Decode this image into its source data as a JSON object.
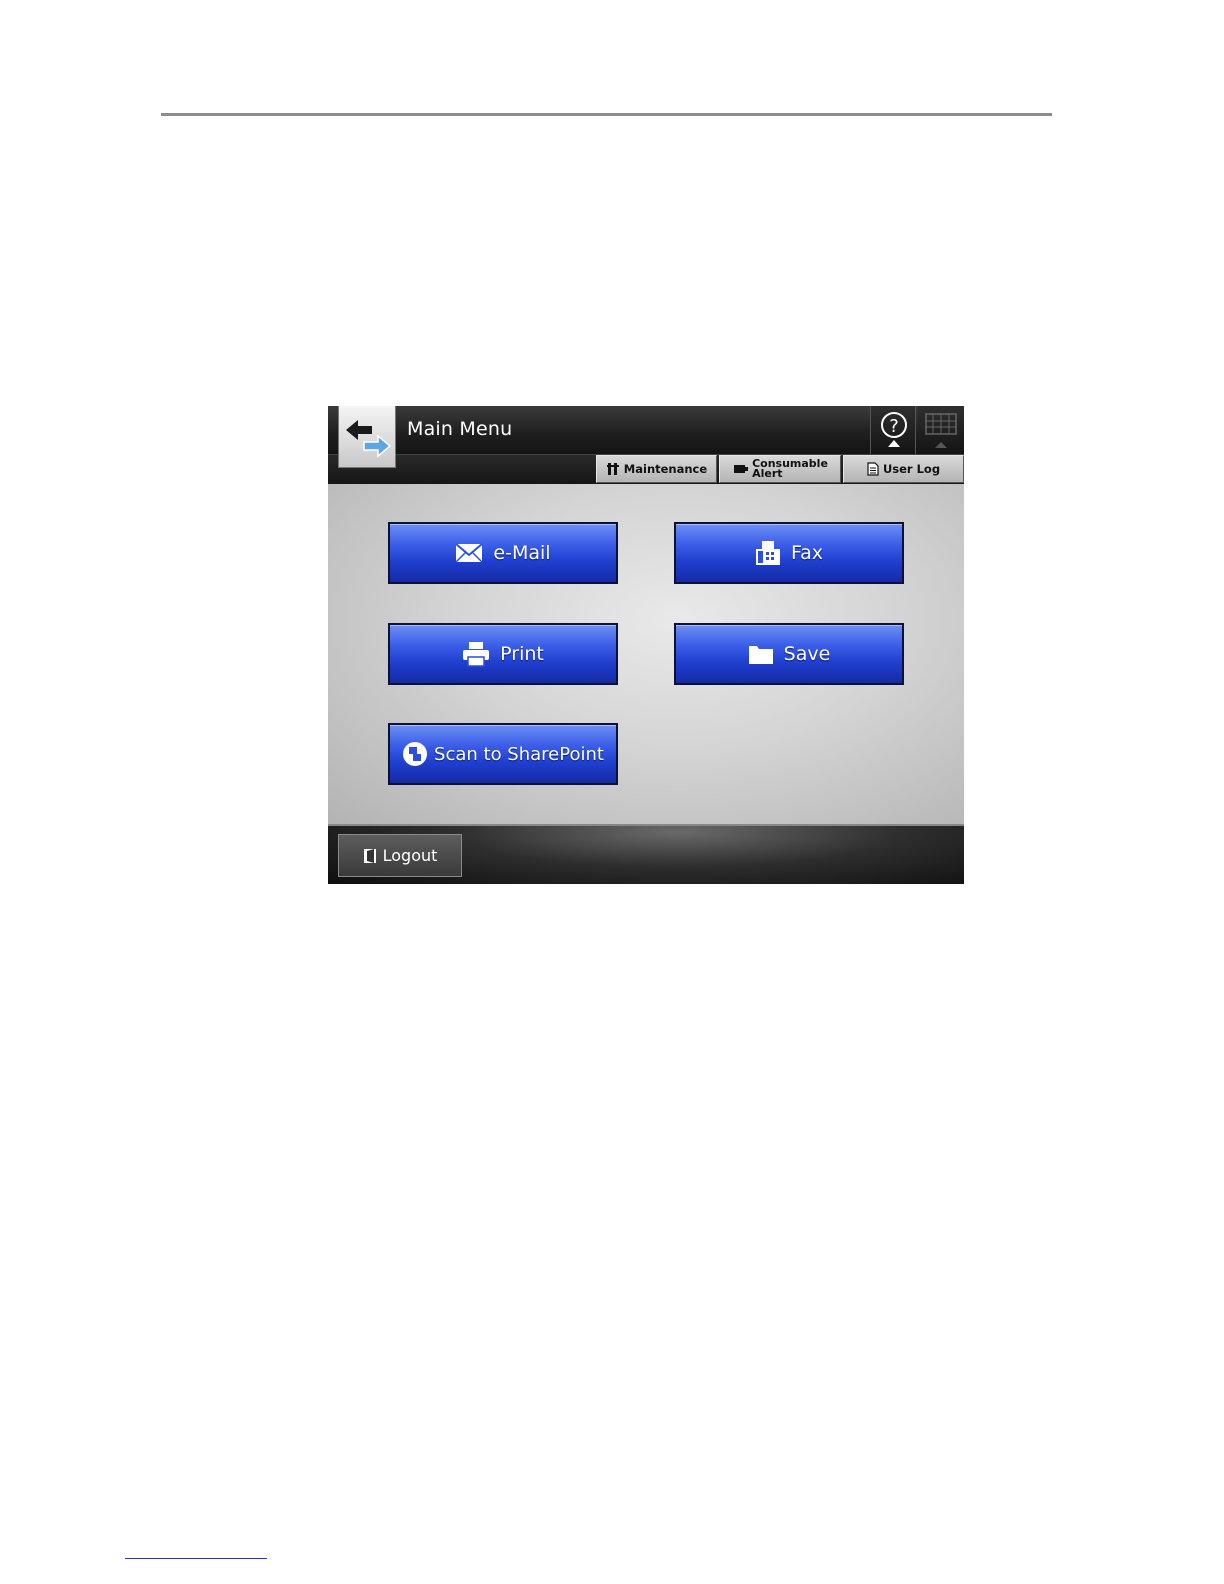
{
  "screen": {
    "title": "Main Menu",
    "toolbar": {
      "maintenance": "Maintenance",
      "consumable_line1": "Consumable",
      "consumable_line2": "Alert",
      "user_log": "User Log"
    },
    "menu": {
      "email": "e-Mail",
      "fax": "Fax",
      "print": "Print",
      "save": "Save",
      "scan_sharepoint": "Scan to SharePoint"
    },
    "footer": {
      "logout": "Logout"
    }
  },
  "colors": {
    "button_blue": "#2a4ee0",
    "titlebar": "#1e1e1e",
    "background": "#d4d4d4"
  },
  "icons": [
    "back-arrows-icon",
    "help-icon",
    "keyboard-icon",
    "maintenance-icon",
    "consumable-alert-icon",
    "user-log-icon",
    "envelope-icon",
    "fax-icon",
    "printer-icon",
    "folder-icon",
    "sharepoint-icon",
    "logout-icon"
  ]
}
